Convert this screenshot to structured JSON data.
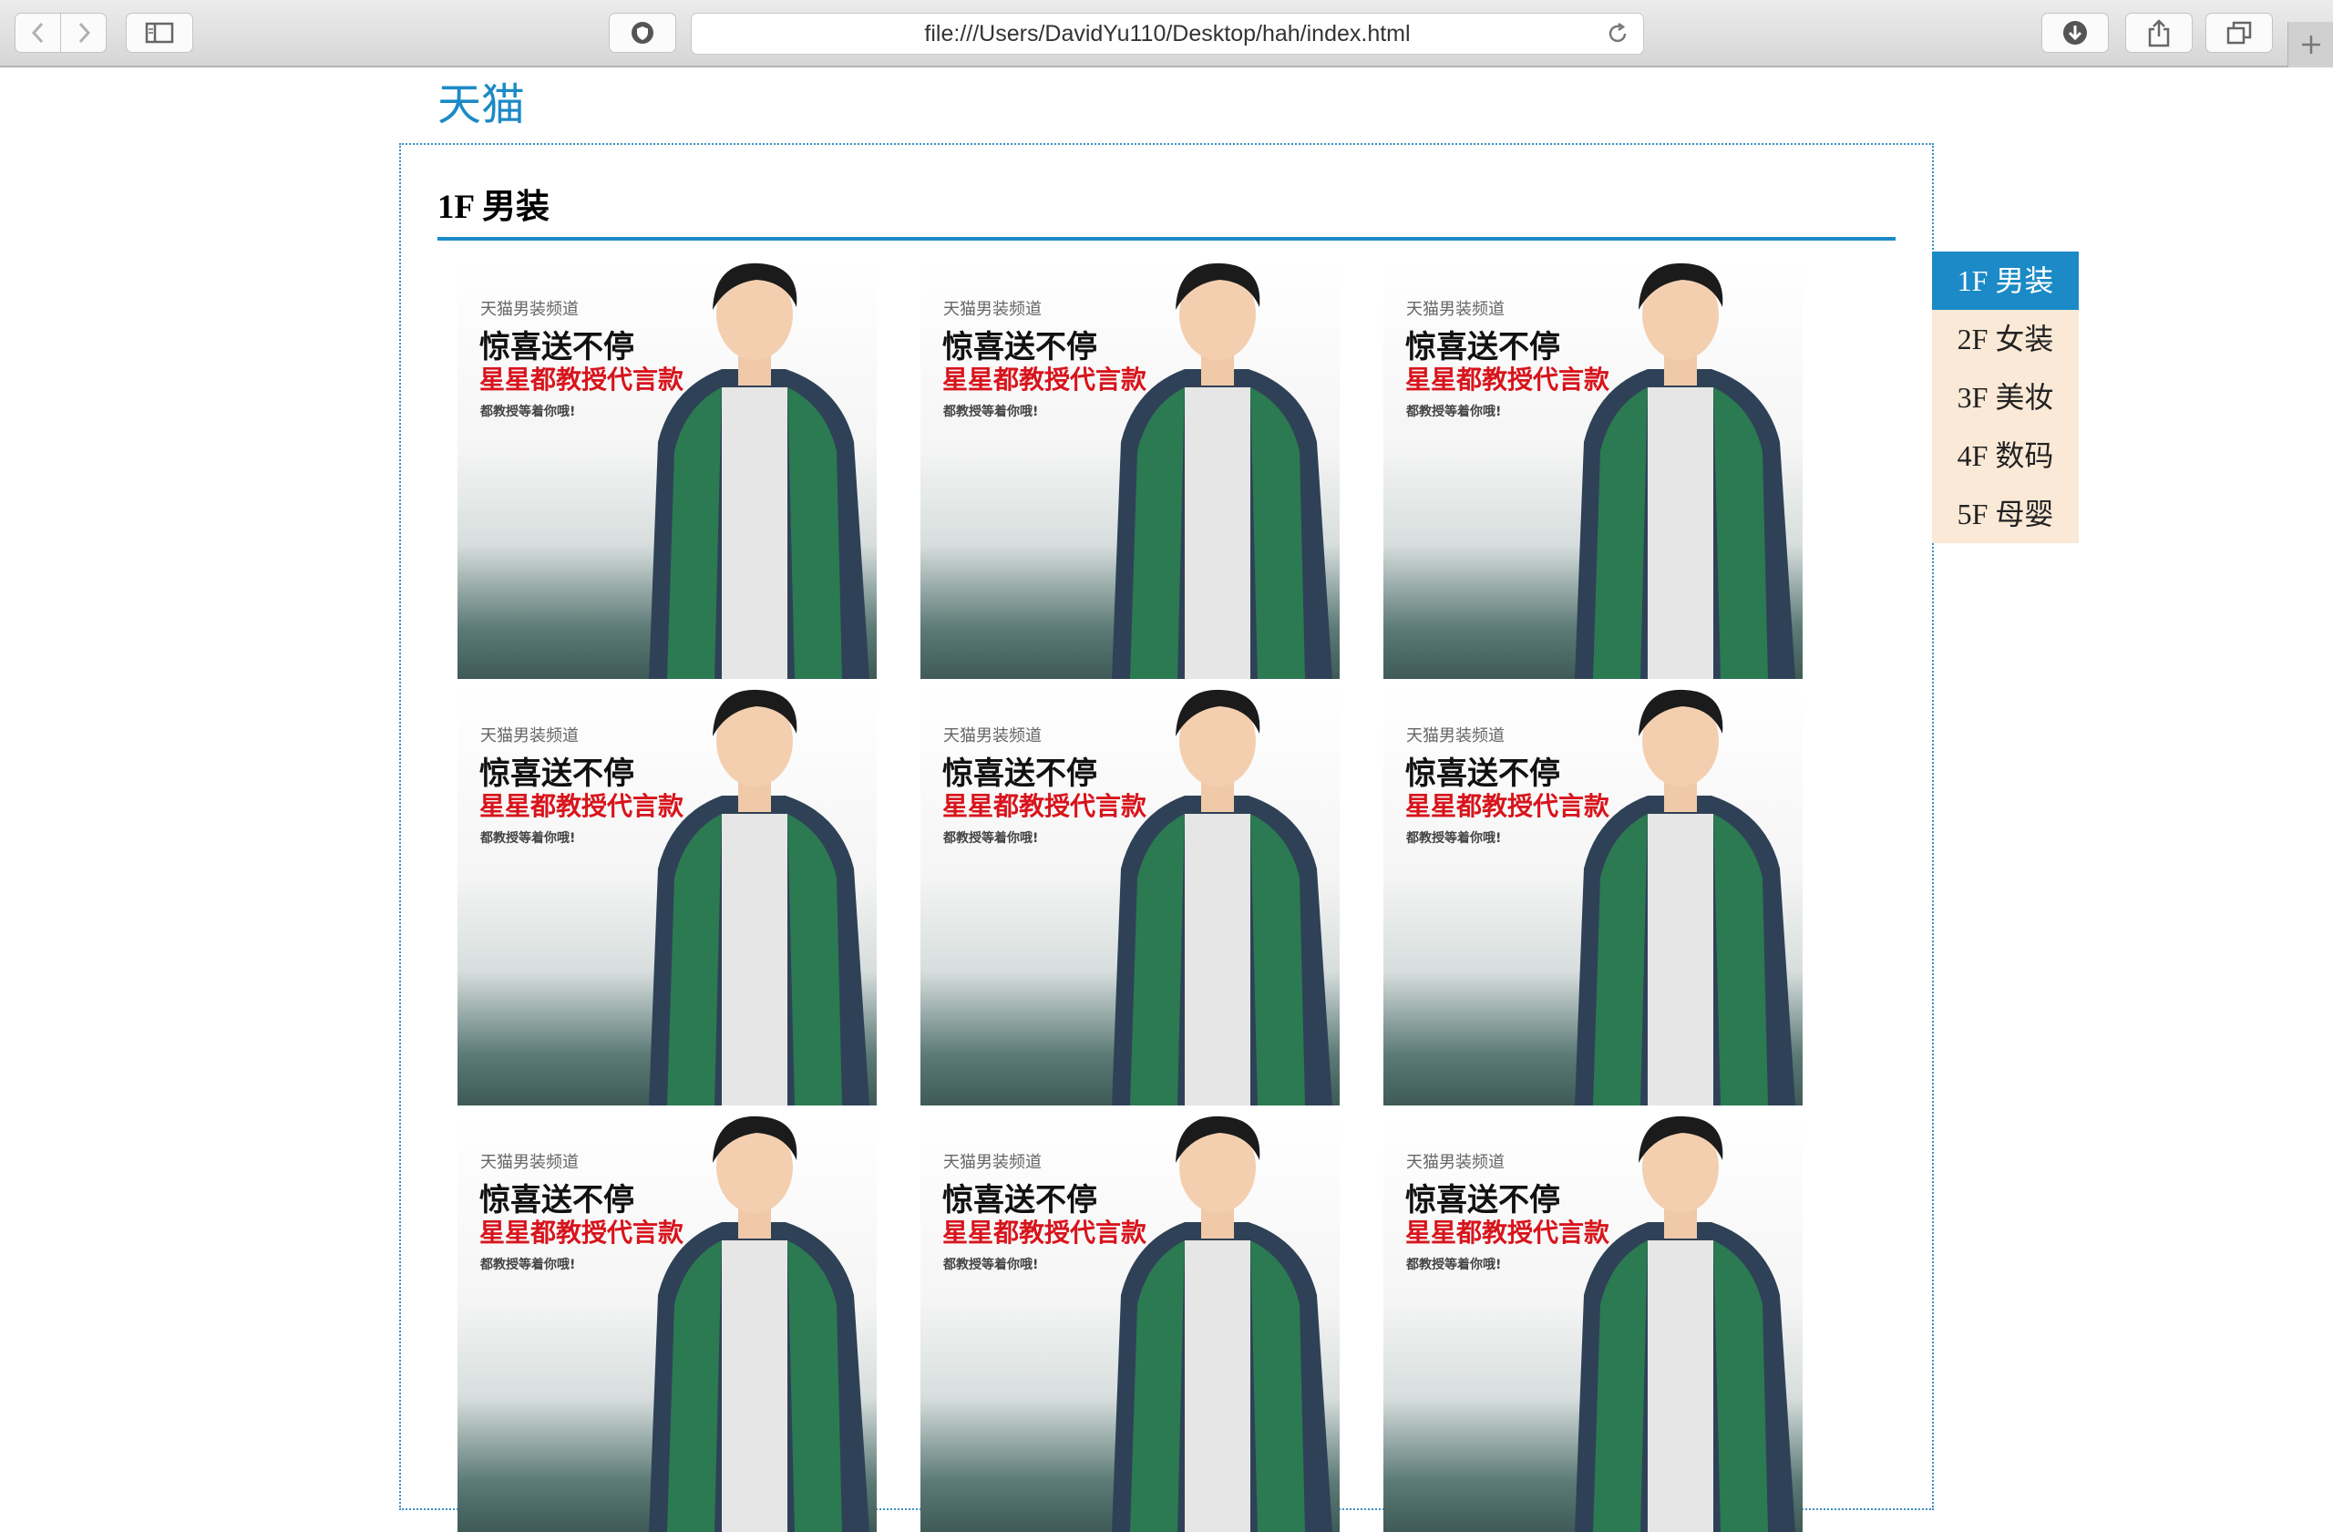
{
  "browser": {
    "url": "file:///Users/DavidYu110/Desktop/hah/index.html"
  },
  "page": {
    "title": "天猫",
    "section_heading": "1F 男装",
    "promo": {
      "line1": "天猫男装频道",
      "line2": "惊喜送不停",
      "line3": "星星都教授代言款",
      "line4": "都教授等着你哦!"
    },
    "floor_nav": [
      {
        "label": "1F 男装",
        "active": true
      },
      {
        "label": "2F 女装",
        "active": false
      },
      {
        "label": "3F 美妆",
        "active": false
      },
      {
        "label": "4F 数码",
        "active": false
      },
      {
        "label": "5F 母婴",
        "active": false
      }
    ]
  },
  "colors": {
    "accent": "#1c8ac6",
    "nav_bg": "#fae9d6",
    "promo_red": "#d8141c"
  }
}
